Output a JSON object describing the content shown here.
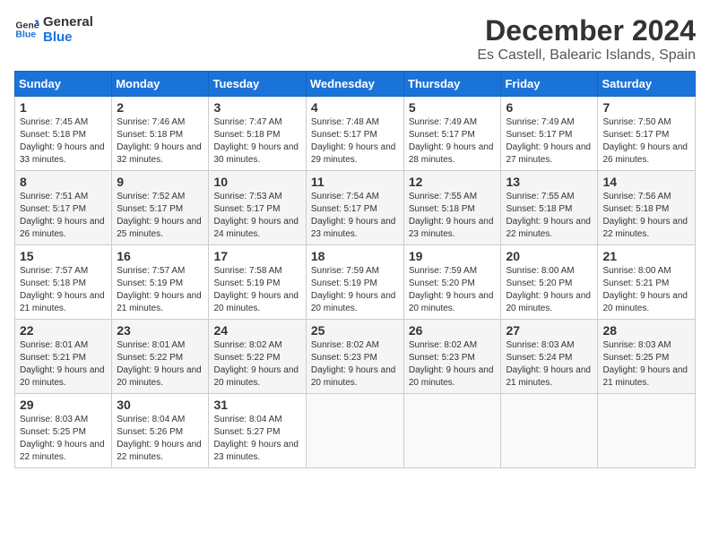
{
  "header": {
    "logo_line1": "General",
    "logo_line2": "Blue",
    "title": "December 2024",
    "subtitle": "Es Castell, Balearic Islands, Spain"
  },
  "calendar": {
    "days_of_week": [
      "Sunday",
      "Monday",
      "Tuesday",
      "Wednesday",
      "Thursday",
      "Friday",
      "Saturday"
    ],
    "weeks": [
      [
        {
          "day": "",
          "info": ""
        },
        {
          "day": "",
          "info": ""
        },
        {
          "day": "",
          "info": ""
        },
        {
          "day": "",
          "info": ""
        },
        {
          "day": "5",
          "info": "Sunrise: 7:49 AM\nSunset: 5:17 PM\nDaylight: 9 hours and 28 minutes."
        },
        {
          "day": "6",
          "info": "Sunrise: 7:49 AM\nSunset: 5:17 PM\nDaylight: 9 hours and 27 minutes."
        },
        {
          "day": "7",
          "info": "Sunrise: 7:50 AM\nSunset: 5:17 PM\nDaylight: 9 hours and 26 minutes."
        }
      ],
      [
        {
          "day": "1",
          "info": "Sunrise: 7:45 AM\nSunset: 5:18 PM\nDaylight: 9 hours and 33 minutes."
        },
        {
          "day": "2",
          "info": "Sunrise: 7:46 AM\nSunset: 5:18 PM\nDaylight: 9 hours and 32 minutes."
        },
        {
          "day": "3",
          "info": "Sunrise: 7:47 AM\nSunset: 5:18 PM\nDaylight: 9 hours and 30 minutes."
        },
        {
          "day": "4",
          "info": "Sunrise: 7:48 AM\nSunset: 5:17 PM\nDaylight: 9 hours and 29 minutes."
        },
        {
          "day": "5",
          "info": "Sunrise: 7:49 AM\nSunset: 5:17 PM\nDaylight: 9 hours and 28 minutes."
        },
        {
          "day": "6",
          "info": "Sunrise: 7:49 AM\nSunset: 5:17 PM\nDaylight: 9 hours and 27 minutes."
        },
        {
          "day": "7",
          "info": "Sunrise: 7:50 AM\nSunset: 5:17 PM\nDaylight: 9 hours and 26 minutes."
        }
      ],
      [
        {
          "day": "8",
          "info": "Sunrise: 7:51 AM\nSunset: 5:17 PM\nDaylight: 9 hours and 26 minutes."
        },
        {
          "day": "9",
          "info": "Sunrise: 7:52 AM\nSunset: 5:17 PM\nDaylight: 9 hours and 25 minutes."
        },
        {
          "day": "10",
          "info": "Sunrise: 7:53 AM\nSunset: 5:17 PM\nDaylight: 9 hours and 24 minutes."
        },
        {
          "day": "11",
          "info": "Sunrise: 7:54 AM\nSunset: 5:17 PM\nDaylight: 9 hours and 23 minutes."
        },
        {
          "day": "12",
          "info": "Sunrise: 7:55 AM\nSunset: 5:18 PM\nDaylight: 9 hours and 23 minutes."
        },
        {
          "day": "13",
          "info": "Sunrise: 7:55 AM\nSunset: 5:18 PM\nDaylight: 9 hours and 22 minutes."
        },
        {
          "day": "14",
          "info": "Sunrise: 7:56 AM\nSunset: 5:18 PM\nDaylight: 9 hours and 22 minutes."
        }
      ],
      [
        {
          "day": "15",
          "info": "Sunrise: 7:57 AM\nSunset: 5:18 PM\nDaylight: 9 hours and 21 minutes."
        },
        {
          "day": "16",
          "info": "Sunrise: 7:57 AM\nSunset: 5:19 PM\nDaylight: 9 hours and 21 minutes."
        },
        {
          "day": "17",
          "info": "Sunrise: 7:58 AM\nSunset: 5:19 PM\nDaylight: 9 hours and 20 minutes."
        },
        {
          "day": "18",
          "info": "Sunrise: 7:59 AM\nSunset: 5:19 PM\nDaylight: 9 hours and 20 minutes."
        },
        {
          "day": "19",
          "info": "Sunrise: 7:59 AM\nSunset: 5:20 PM\nDaylight: 9 hours and 20 minutes."
        },
        {
          "day": "20",
          "info": "Sunrise: 8:00 AM\nSunset: 5:20 PM\nDaylight: 9 hours and 20 minutes."
        },
        {
          "day": "21",
          "info": "Sunrise: 8:00 AM\nSunset: 5:21 PM\nDaylight: 9 hours and 20 minutes."
        }
      ],
      [
        {
          "day": "22",
          "info": "Sunrise: 8:01 AM\nSunset: 5:21 PM\nDaylight: 9 hours and 20 minutes."
        },
        {
          "day": "23",
          "info": "Sunrise: 8:01 AM\nSunset: 5:22 PM\nDaylight: 9 hours and 20 minutes."
        },
        {
          "day": "24",
          "info": "Sunrise: 8:02 AM\nSunset: 5:22 PM\nDaylight: 9 hours and 20 minutes."
        },
        {
          "day": "25",
          "info": "Sunrise: 8:02 AM\nSunset: 5:23 PM\nDaylight: 9 hours and 20 minutes."
        },
        {
          "day": "26",
          "info": "Sunrise: 8:02 AM\nSunset: 5:23 PM\nDaylight: 9 hours and 20 minutes."
        },
        {
          "day": "27",
          "info": "Sunrise: 8:03 AM\nSunset: 5:24 PM\nDaylight: 9 hours and 21 minutes."
        },
        {
          "day": "28",
          "info": "Sunrise: 8:03 AM\nSunset: 5:25 PM\nDaylight: 9 hours and 21 minutes."
        }
      ],
      [
        {
          "day": "29",
          "info": "Sunrise: 8:03 AM\nSunset: 5:25 PM\nDaylight: 9 hours and 22 minutes."
        },
        {
          "day": "30",
          "info": "Sunrise: 8:04 AM\nSunset: 5:26 PM\nDaylight: 9 hours and 22 minutes."
        },
        {
          "day": "31",
          "info": "Sunrise: 8:04 AM\nSunset: 5:27 PM\nDaylight: 9 hours and 23 minutes."
        },
        {
          "day": "",
          "info": ""
        },
        {
          "day": "",
          "info": ""
        },
        {
          "day": "",
          "info": ""
        },
        {
          "day": "",
          "info": ""
        }
      ]
    ]
  }
}
